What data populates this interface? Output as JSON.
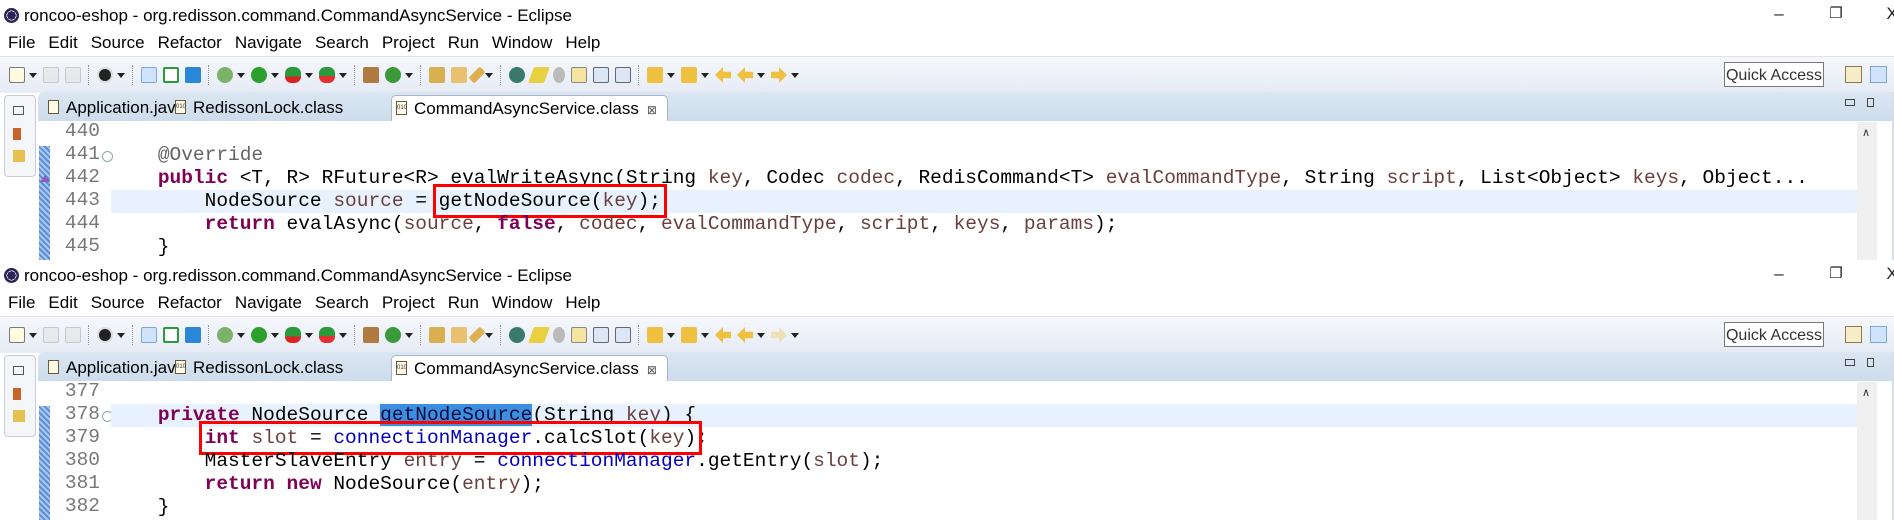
{
  "colors": {
    "keyword": "#7f0055",
    "field": "#0000c0",
    "local_variable": "#6a3e3e",
    "annotation": "#646464",
    "highlight_box": "#ff0000",
    "current_line": "#e8f2fe",
    "tab_bar": "#cddcec"
  },
  "toolbar_icons": [
    "new-wizard-icon",
    "dropdown",
    "save-icon",
    "save-all-icon",
    "sep",
    "profile-icon",
    "dropdown",
    "sep",
    "skip-breakpoints-icon",
    "performance-monitor-icon",
    "text-assist-icon",
    "sep",
    "debug-icon",
    "dropdown",
    "run-icon",
    "dropdown",
    "coverage-icon",
    "dropdown",
    "external-tools-icon",
    "dropdown",
    "sep",
    "new-java-package-icon",
    "new-java-class-icon",
    "dropdown",
    "sep",
    "open-type-icon",
    "open-task-icon",
    "search-icon",
    "dropdown",
    "sep",
    "pin-editor-icon",
    "mark-occurrences-icon",
    "toggle-breadcrumb-icon",
    "toggle-block-selection-icon",
    "show-whitespace-icon",
    "show-paragraph-icon",
    "sep",
    "next-annotation-icon",
    "dropdown",
    "previous-annotation-icon",
    "dropdown",
    "last-edit-location-icon",
    "back-icon",
    "dropdown",
    "forward-icon",
    "dropdown"
  ],
  "windows": [
    {
      "title": "roncoo-eshop - org.redisson.command.CommandAsyncService - Eclipse",
      "window_controls": {
        "minimize": "–",
        "restore": "❐",
        "close": "X"
      },
      "menu": [
        "File",
        "Edit",
        "Source",
        "Refactor",
        "Navigate",
        "Search",
        "Project",
        "Run",
        "Window",
        "Help"
      ],
      "quick_access": "Quick Access",
      "forward_enabled": true,
      "tabs": [
        {
          "label": "Application.java",
          "icon": "java-file-icon",
          "active": false
        },
        {
          "label": "RedissonLock.class",
          "icon": "class-file-icon",
          "active": false
        },
        {
          "label": "CommandAsyncService.class",
          "icon": "class-file-icon",
          "active": true,
          "close": "⊠"
        }
      ],
      "lines": [
        {
          "num": "440",
          "tokens": []
        },
        {
          "num": "441",
          "fold": "⊖",
          "tokens": [
            [
              "",
              "    "
            ],
            [
              "a",
              "@Override"
            ]
          ]
        },
        {
          "num": "442",
          "override_marker": true,
          "tokens": [
            [
              "",
              "    "
            ],
            [
              "k",
              "public"
            ],
            [
              "",
              " <T, R> RFuture<R> evalWriteAsync(String "
            ],
            [
              "v",
              "key"
            ],
            [
              "",
              ", Codec "
            ],
            [
              "v",
              "codec"
            ],
            [
              "",
              ", RedisCommand<T> "
            ],
            [
              "v",
              "evalCommandType"
            ],
            [
              "",
              ", String "
            ],
            [
              "v",
              "script"
            ],
            [
              "",
              ", List<Object> "
            ],
            [
              "v",
              "keys"
            ],
            [
              "",
              ", Object..."
            ]
          ]
        },
        {
          "num": "443",
          "current": true,
          "boxed": [
            3,
            6
          ],
          "tokens": [
            [
              "",
              "        NodeSource "
            ],
            [
              "v",
              "source"
            ],
            [
              "",
              " = "
            ],
            [
              "",
              "getNodeSource("
            ],
            [
              "v",
              "key"
            ],
            [
              "",
              ");"
            ]
          ]
        },
        {
          "num": "444",
          "tokens": [
            [
              "",
              "        "
            ],
            [
              "k",
              "return"
            ],
            [
              "",
              " evalAsync("
            ],
            [
              "v",
              "source"
            ],
            [
              "",
              ", "
            ],
            [
              "k",
              "false"
            ],
            [
              "",
              ", "
            ],
            [
              "v",
              "codec"
            ],
            [
              "",
              ", "
            ],
            [
              "v",
              "evalCommandType"
            ],
            [
              "",
              ", "
            ],
            [
              "v",
              "script"
            ],
            [
              "",
              ", "
            ],
            [
              "v",
              "keys"
            ],
            [
              "",
              ", "
            ],
            [
              "v",
              "params"
            ],
            [
              "",
              ");"
            ]
          ]
        },
        {
          "num": "445",
          "tokens": [
            [
              "",
              "    }"
            ]
          ]
        }
      ]
    },
    {
      "title": "roncoo-eshop - org.redisson.command.CommandAsyncService - Eclipse",
      "window_controls": {
        "minimize": "–",
        "restore": "❐",
        "close": "X"
      },
      "menu": [
        "File",
        "Edit",
        "Source",
        "Refactor",
        "Navigate",
        "Search",
        "Project",
        "Run",
        "Window",
        "Help"
      ],
      "quick_access": "Quick Access",
      "forward_enabled": false,
      "tabs": [
        {
          "label": "Application.java",
          "icon": "java-file-icon",
          "active": false
        },
        {
          "label": "RedissonLock.class",
          "icon": "class-file-icon",
          "active": false
        },
        {
          "label": "CommandAsyncService.class",
          "icon": "class-file-icon",
          "active": true,
          "close": "⊠"
        }
      ],
      "lines": [
        {
          "num": "377",
          "tokens": []
        },
        {
          "num": "378",
          "fold": "⊖",
          "current": true,
          "tokens": [
            [
              "",
              "    "
            ],
            [
              "k",
              "private"
            ],
            [
              "",
              " NodeSource "
            ],
            [
              "sel",
              "getNodeSource"
            ],
            [
              "",
              "(String "
            ],
            [
              "v",
              "key"
            ],
            [
              "",
              ") {"
            ]
          ]
        },
        {
          "num": "379",
          "boxed": [
            1,
            9
          ],
          "tokens": [
            [
              "",
              "        "
            ],
            [
              "k",
              "int"
            ],
            [
              "",
              " "
            ],
            [
              "v",
              "slot"
            ],
            [
              "",
              " = "
            ],
            [
              "f",
              "connectionManager"
            ],
            [
              "",
              ".calcSlot("
            ],
            [
              "v",
              "key"
            ],
            [
              "",
              ")"
            ],
            [
              "",
              ";"
            ]
          ]
        },
        {
          "num": "380",
          "tokens": [
            [
              "",
              "        MasterSlaveEntry "
            ],
            [
              "v",
              "entry"
            ],
            [
              "",
              " = "
            ],
            [
              "f",
              "connectionManager"
            ],
            [
              "",
              ".getEntry("
            ],
            [
              "v",
              "slot"
            ],
            [
              "",
              ");"
            ]
          ]
        },
        {
          "num": "381",
          "tokens": [
            [
              "",
              "        "
            ],
            [
              "k",
              "return"
            ],
            [
              "",
              " "
            ],
            [
              "k",
              "new"
            ],
            [
              "",
              " NodeSource("
            ],
            [
              "v",
              "entry"
            ],
            [
              "",
              ");"
            ]
          ]
        },
        {
          "num": "382",
          "tokens": [
            [
              "",
              "    }"
            ]
          ]
        }
      ]
    }
  ]
}
